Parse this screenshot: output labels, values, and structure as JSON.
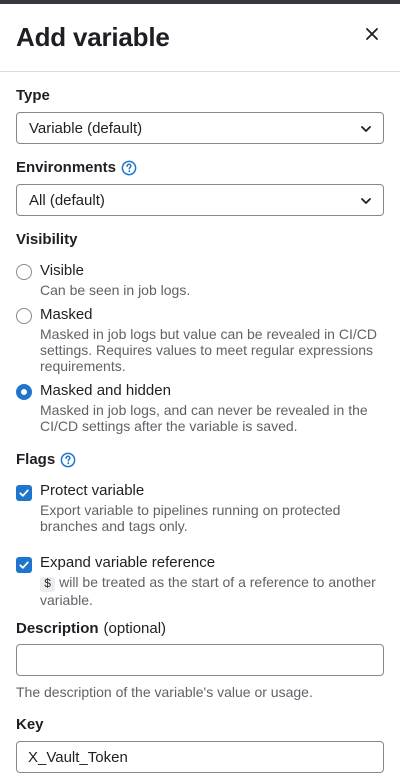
{
  "header": {
    "title": "Add variable",
    "close_icon": "close-icon"
  },
  "type": {
    "label": "Type",
    "selected": "Variable (default)"
  },
  "environments": {
    "label": "Environments",
    "help_icon": "question-circle-icon",
    "selected": "All (default)"
  },
  "visibility": {
    "label": "Visibility",
    "options": [
      {
        "title": "Visible",
        "help": "Can be seen in job logs.",
        "checked": false
      },
      {
        "title": "Masked",
        "help": "Masked in job logs but value can be revealed in CI/CD settings. Requires values to meet regular expressions requirements.",
        "checked": false
      },
      {
        "title": "Masked and hidden",
        "help": "Masked in job logs, and can never be revealed in the CI/CD settings after the variable is saved.",
        "checked": true
      }
    ]
  },
  "flags": {
    "label": "Flags",
    "help_icon": "question-circle-icon",
    "protect": {
      "title": "Protect variable",
      "help": "Export variable to pipelines running on protected branches and tags only.",
      "checked": true
    },
    "expand": {
      "title": "Expand variable reference",
      "code": "$",
      "help": "will be treated as the start of a reference to another variable.",
      "checked": true
    }
  },
  "description": {
    "label": "Description",
    "optional": "(optional)",
    "value": "",
    "help": "The description of the variable's value or usage."
  },
  "key": {
    "label": "Key",
    "value": "X_Vault_Token"
  },
  "colors": {
    "accent": "#1f75cb",
    "text": "#1f1e24",
    "muted": "#626168",
    "border": "#89888d"
  }
}
